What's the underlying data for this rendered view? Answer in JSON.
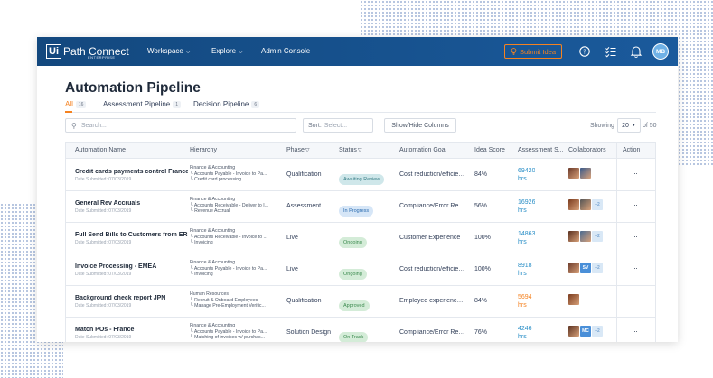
{
  "topbar": {
    "logo_box": "Ui",
    "logo_text": "Path Connect",
    "logo_sub": "ENTERPRISE",
    "nav": [
      {
        "label": "Workspace",
        "has_dropdown": true
      },
      {
        "label": "Explore",
        "has_dropdown": true
      },
      {
        "label": "Admin Console",
        "has_dropdown": false
      }
    ],
    "submit_label": "Submit Idea",
    "avatar_initials": "MB"
  },
  "page": {
    "title": "Automation Pipeline",
    "tabs": [
      {
        "label": "All",
        "count": "16",
        "active": true
      },
      {
        "label": "Assessment Pipeline",
        "count": "1",
        "active": false
      },
      {
        "label": "Decision Pipeline",
        "count": "6",
        "active": false
      }
    ]
  },
  "toolbar": {
    "search_placeholder": "Search...",
    "sort_label": "Sort:",
    "sort_placeholder": "Select...",
    "showhide_label": "Show/Hide Columns",
    "showing_label": "Showing",
    "page_size": "20",
    "of_total": "of 50"
  },
  "table": {
    "headers": [
      "Automation Name",
      "Hierarchy",
      "Phase",
      "Status",
      "Automation Goal",
      "Idea Score",
      "Assessment S...",
      "Collaborators",
      "Action"
    ],
    "rows": [
      {
        "name": "Credit cards payments control France",
        "date": "Date Submitted: 07/03/2019",
        "hierarchy": [
          "Finance & Accounting",
          "└ Accounts Payable - Invoice to Pa...",
          "└ Credit card processing"
        ],
        "phase": "Qualification",
        "status": "Awaiting Review",
        "status_bg": "#cfe7ea",
        "status_fg": "#3a7f88",
        "goal": "Cost reduction/efficiency",
        "idea_score": "84%",
        "assessment": "69420",
        "assessment_unit": "hrs",
        "assessment_color": "#2a8fc7",
        "collaborators": [
          {
            "type": "photo",
            "color": "#6b3a2a"
          },
          {
            "type": "photo",
            "color": "#3a5a8a"
          }
        ],
        "action": "···"
      },
      {
        "name": "General Rev Accruals",
        "date": "Date Submitted: 07/03/2019",
        "hierarchy": [
          "Finance & Accounting",
          "└ Accounts Receivable - Deliver to I...",
          "└ Revenue Accrual"
        ],
        "phase": "Assessment",
        "status": "In Progress",
        "status_bg": "#d6e6f7",
        "status_fg": "#2b6cb0",
        "goal": "Compliance/Error Redu...",
        "idea_score": "56%",
        "assessment": "16926",
        "assessment_unit": "hrs",
        "assessment_color": "#2a8fc7",
        "collaborators": [
          {
            "type": "photo",
            "color": "#7a3b1e"
          },
          {
            "type": "photo",
            "color": "#555555"
          },
          {
            "type": "more",
            "label": "+2"
          }
        ],
        "action": "···"
      },
      {
        "name": "Full Send Bills to Customers from ERP",
        "date": "Date Submitted: 07/03/2019",
        "hierarchy": [
          "Finance & Accounting",
          "└ Accounts Receivable - Invoice to ...",
          "└ Invoicing"
        ],
        "phase": "Live",
        "status": "Ongoing",
        "status_bg": "#d4ecd8",
        "status_fg": "#3b8a4e",
        "goal": "Customer Experience",
        "idea_score": "100%",
        "assessment": "14863",
        "assessment_unit": "hrs",
        "assessment_color": "#2a8fc7",
        "collaborators": [
          {
            "type": "photo",
            "color": "#5a3020"
          },
          {
            "type": "photo",
            "color": "#4a6a90"
          },
          {
            "type": "more",
            "label": "+2"
          }
        ],
        "action": "···"
      },
      {
        "name": "Invoice Processing - EMEA",
        "date": "Date Submitted: 07/03/2019",
        "hierarchy": [
          "Finance & Accounting",
          "└ Accounts Payable - Invoice to Pa...",
          "└ Invoicing"
        ],
        "phase": "Live",
        "status": "Ongoing",
        "status_bg": "#d4ecd8",
        "status_fg": "#3b8a4e",
        "goal": "Cost reduction/efficiency",
        "idea_score": "100%",
        "assessment": "8918",
        "assessment_unit": "hrs",
        "assessment_color": "#2a8fc7",
        "collaborators": [
          {
            "type": "photo",
            "color": "#6b3a2a"
          },
          {
            "type": "initials",
            "label": "SV",
            "color": "#4a8fd8"
          },
          {
            "type": "more",
            "label": "+2"
          }
        ],
        "action": "···"
      },
      {
        "name": "Background check report JPN",
        "date": "Date Submitted: 07/03/2019",
        "hierarchy": [
          "Human Resources",
          "└ Recruit & Onboard Employees",
          "└ Manage Pre-Employment Verific..."
        ],
        "phase": "Qualification",
        "status": "Approved",
        "status_bg": "#d4ecd8",
        "status_fg": "#3b8a4e",
        "goal": "Employee experience/s...",
        "idea_score": "84%",
        "assessment": "5694",
        "assessment_unit": "hrs",
        "assessment_color": "#f58220",
        "collaborators": [
          {
            "type": "photo",
            "color": "#7a3b1e"
          }
        ],
        "action": "···"
      },
      {
        "name": "Match POs - France",
        "date": "Date Submitted: 07/03/2019",
        "hierarchy": [
          "Finance & Accounting",
          "└ Accounts Payable - Invoice to Pa...",
          "└ Matching of invoices w/ purchas..."
        ],
        "phase": "Solution Design",
        "status": "On Track",
        "status_bg": "#d4ecd8",
        "status_fg": "#3b8a4e",
        "goal": "Compliance/Error Redu...",
        "idea_score": "76%",
        "assessment": "4246",
        "assessment_unit": "hrs",
        "assessment_color": "#2a8fc7",
        "collaborators": [
          {
            "type": "photo",
            "color": "#5a3020"
          },
          {
            "type": "initials",
            "label": "MC",
            "color": "#4a8fd8"
          },
          {
            "type": "more",
            "label": "+2"
          }
        ],
        "action": "···"
      }
    ]
  }
}
